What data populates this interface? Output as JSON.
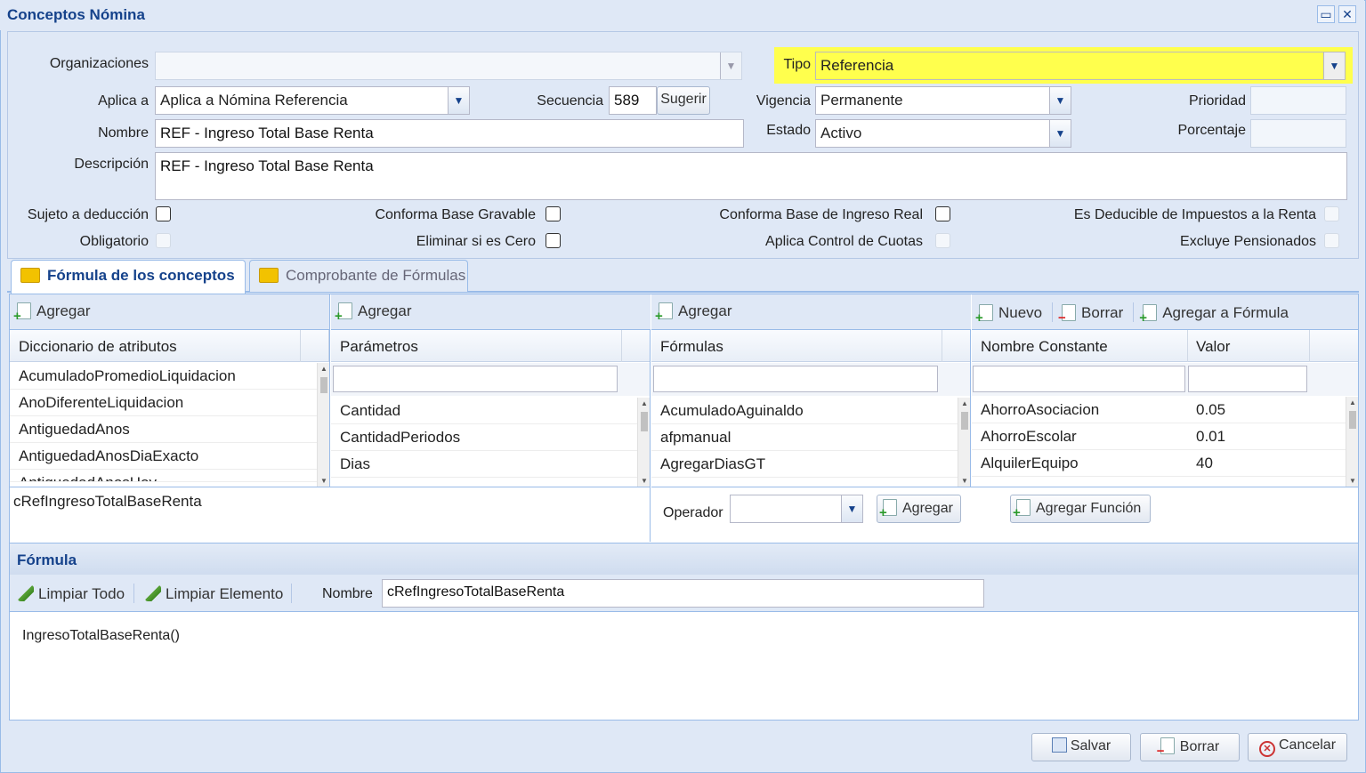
{
  "window": {
    "title": "Conceptos Nómina",
    "maximize_icon": "maximize-icon",
    "close_icon": "close-icon"
  },
  "form": {
    "organizaciones": {
      "label": "Organizaciones",
      "value": ""
    },
    "tipo": {
      "label": "Tipo",
      "value": "Referencia",
      "highlight": "#ffff4d"
    },
    "aplica_a": {
      "label": "Aplica a",
      "value": "Aplica a Nómina Referencia"
    },
    "secuencia": {
      "label": "Secuencia",
      "value": "589",
      "button": "Sugerir"
    },
    "vigencia": {
      "label": "Vigencia",
      "value": "Permanente"
    },
    "prioridad": {
      "label": "Prioridad",
      "value": ""
    },
    "nombre": {
      "label": "Nombre",
      "value": "REF - Ingreso Total Base Renta"
    },
    "estado": {
      "label": "Estado",
      "value": "Activo"
    },
    "porcentaje": {
      "label": "Porcentaje",
      "value": ""
    },
    "descripcion": {
      "label": "Descripción",
      "value": "REF - Ingreso Total Base Renta"
    },
    "checks": {
      "sujeto_deduccion": {
        "label": "Sujeto a deducción",
        "checked": false
      },
      "conforma_base_gravable": {
        "label": "Conforma Base Gravable",
        "checked": false
      },
      "conforma_base_ingreso_real": {
        "label": "Conforma Base de Ingreso Real",
        "checked": false
      },
      "es_deducible": {
        "label": "Es Deducible de Impuestos a la Renta",
        "checked": false
      },
      "obligatorio": {
        "label": "Obligatorio",
        "checked": false
      },
      "eliminar_si_cero": {
        "label": "Eliminar si es Cero",
        "checked": false
      },
      "aplica_control_cuotas": {
        "label": "Aplica Control de Cuotas",
        "checked": false
      },
      "excluye_pensionados": {
        "label": "Excluye Pensionados",
        "checked": false
      }
    }
  },
  "tabs": [
    {
      "label": "Fórmula de los conceptos",
      "icon": "folder-icon",
      "active": true
    },
    {
      "label": "Comprobante de Fórmulas",
      "icon": "folder-icon",
      "active": false
    }
  ],
  "grids": {
    "atributos": {
      "toolbar": "Agregar",
      "header": "Diccionario de atributos",
      "rows": [
        "AcumuladoPromedioLiquidacion",
        "AnoDiferenteLiquidacion",
        "AntiguedadAnos",
        "AntiguedadAnosDiaExacto",
        "AntiguedadAnosHoy"
      ]
    },
    "parametros": {
      "toolbar": "Agregar",
      "header": "Parámetros",
      "rows": [
        "Cantidad",
        "CantidadPeriodos",
        "Dias"
      ]
    },
    "formulas": {
      "toolbar": "Agregar",
      "header": "Fórmulas",
      "rows": [
        "AcumuladoAguinaldo",
        "afpmanual",
        "AgregarDiasGT"
      ]
    },
    "constantes": {
      "toolbar": {
        "nuevo": "Nuevo",
        "borrar": "Borrar",
        "agregar": "Agregar a Fórmula"
      },
      "headers": {
        "nombre": "Nombre Constante",
        "valor": "Valor"
      },
      "rows": [
        {
          "nombre": "AhorroAsociacion",
          "valor": "0.05"
        },
        {
          "nombre": "AhorroEscolar",
          "valor": "0.01"
        },
        {
          "nombre": "AlquilerEquipo",
          "valor": "40"
        }
      ]
    }
  },
  "expression": {
    "value": "cRefIngresoTotalBaseRenta"
  },
  "operador": {
    "label": "Operador",
    "value": "",
    "agregar": "Agregar",
    "agregar_funcion": "Agregar Función"
  },
  "formula": {
    "title": "Fórmula",
    "limpiar_todo": "Limpiar Todo",
    "limpiar_elemento": "Limpiar Elemento",
    "nombre_label": "Nombre",
    "nombre_value": "cRefIngresoTotalBaseRenta",
    "content": "IngresoTotalBaseRenta()"
  },
  "footer": {
    "salvar": "Salvar",
    "borrar": "Borrar",
    "cancelar": "Cancelar"
  }
}
